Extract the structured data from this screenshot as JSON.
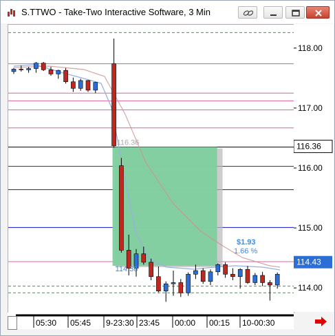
{
  "window": {
    "title": "S.TTWO - Take-Two Interactive Software, 3 Min",
    "icon": "chart-app-icon"
  },
  "titlebar_buttons": [
    "link-icon",
    "minimize-icon",
    "restore-icon",
    "close-icon"
  ],
  "price_axis": {
    "labels": [
      "118.00",
      "117.00",
      "116.00",
      "115.00",
      "114.00"
    ],
    "current_price_tag": "114.43",
    "entry_price_tag": "116.36"
  },
  "time_axis": {
    "labels": [
      "05:30",
      "05:45",
      "9-23:30",
      "23:45",
      "00:00",
      "00:15",
      "10-00:30"
    ]
  },
  "annotations": {
    "entry_label": "116.36",
    "exit_label": "114.38",
    "profit_amount": "$1.93",
    "profit_percent": "1.66 %"
  },
  "colors": {
    "up_candle": "#2b6fd6",
    "down_candle": "#c0281f",
    "trade_box": "#7fcf9f",
    "profit_text": "#3a8ee6",
    "blue_level": "#1010c8",
    "dark_red_level": "#a01010",
    "maroon_level": "#800060"
  },
  "chart_data": {
    "type": "candlestick",
    "symbol": "S.TTWO",
    "interval": "3 Min",
    "ylim": [
      113.6,
      118.4
    ],
    "candles": [
      {
        "o": 117.62,
        "h": 117.68,
        "l": 117.58,
        "c": 117.66
      },
      {
        "o": 117.66,
        "h": 117.72,
        "l": 117.62,
        "c": 117.65
      },
      {
        "o": 117.65,
        "h": 117.7,
        "l": 117.6,
        "c": 117.67
      },
      {
        "o": 117.67,
        "h": 117.78,
        "l": 117.6,
        "c": 117.76
      },
      {
        "o": 117.76,
        "h": 117.78,
        "l": 117.63,
        "c": 117.65
      },
      {
        "o": 117.65,
        "h": 117.7,
        "l": 117.55,
        "c": 117.58
      },
      {
        "o": 117.58,
        "h": 117.65,
        "l": 117.5,
        "c": 117.64
      },
      {
        "o": 117.64,
        "h": 117.68,
        "l": 117.42,
        "c": 117.45
      },
      {
        "o": 117.45,
        "h": 117.52,
        "l": 117.28,
        "c": 117.34
      },
      {
        "o": 117.34,
        "h": 117.5,
        "l": 117.3,
        "c": 117.47
      },
      {
        "o": 117.47,
        "h": 117.48,
        "l": 117.28,
        "c": 117.31
      },
      {
        "o": 117.31,
        "h": 117.45,
        "l": 117.26,
        "c": 117.44
      },
      {
        "o": 117.75,
        "h": 118.17,
        "l": 116.35,
        "c": 116.38
      },
      {
        "o": 116.05,
        "h": 116.18,
        "l": 114.6,
        "c": 114.64
      },
      {
        "o": 114.64,
        "h": 114.9,
        "l": 114.22,
        "c": 114.34
      },
      {
        "o": 114.34,
        "h": 114.66,
        "l": 114.2,
        "c": 114.58
      },
      {
        "o": 114.58,
        "h": 114.7,
        "l": 114.4,
        "c": 114.44
      },
      {
        "o": 114.44,
        "h": 114.5,
        "l": 114.14,
        "c": 114.2
      },
      {
        "o": 114.2,
        "h": 114.37,
        "l": 113.94,
        "c": 113.96
      },
      {
        "o": 113.96,
        "h": 114.12,
        "l": 113.78,
        "c": 114.08
      },
      {
        "o": 114.08,
        "h": 114.3,
        "l": 113.88,
        "c": 114.1
      },
      {
        "o": 114.1,
        "h": 114.16,
        "l": 113.86,
        "c": 113.93
      },
      {
        "o": 113.93,
        "h": 114.27,
        "l": 113.88,
        "c": 114.24
      },
      {
        "o": 114.24,
        "h": 114.4,
        "l": 114.16,
        "c": 114.3
      },
      {
        "o": 114.3,
        "h": 114.34,
        "l": 114.08,
        "c": 114.12
      },
      {
        "o": 114.12,
        "h": 114.32,
        "l": 114.06,
        "c": 114.28
      },
      {
        "o": 114.28,
        "h": 114.42,
        "l": 114.22,
        "c": 114.4
      },
      {
        "o": 114.4,
        "h": 114.44,
        "l": 114.18,
        "c": 114.24
      },
      {
        "o": 114.24,
        "h": 114.34,
        "l": 114.14,
        "c": 114.2
      },
      {
        "o": 114.2,
        "h": 114.34,
        "l": 114.0,
        "c": 114.32
      },
      {
        "o": 114.32,
        "h": 114.38,
        "l": 114.08,
        "c": 114.1
      },
      {
        "o": 114.1,
        "h": 114.26,
        "l": 114.06,
        "c": 114.22
      },
      {
        "o": 114.22,
        "h": 114.28,
        "l": 114.04,
        "c": 114.1
      },
      {
        "o": 114.1,
        "h": 114.14,
        "l": 113.8,
        "c": 114.06
      },
      {
        "o": 114.06,
        "h": 114.27,
        "l": 114.0,
        "c": 114.24
      }
    ],
    "horizontal_levels": [
      {
        "price": 118.27,
        "color": "#22aa22",
        "dash": true
      },
      {
        "price": 117.75,
        "color": "#888888",
        "dash": false
      },
      {
        "price": 117.26,
        "color": "#e060a0",
        "dash": false
      },
      {
        "price": 117.13,
        "color": "#e060a0",
        "dash": false
      },
      {
        "price": 116.98,
        "color": "#d060c0",
        "dash": false
      },
      {
        "price": 116.68,
        "color": "#e060a0",
        "dash": false
      },
      {
        "price": 116.36,
        "color": "#000000",
        "dash": false
      },
      {
        "price": 116.04,
        "color": "#a01010",
        "dash": false
      },
      {
        "price": 115.65,
        "color": "#800060",
        "dash": false
      },
      {
        "price": 115.02,
        "color": "#1010c8",
        "dash": false
      },
      {
        "price": 114.45,
        "color": "#e060a0",
        "dash": false
      },
      {
        "price": 114.04,
        "color": "#22aa22",
        "dash": true
      },
      {
        "price": 113.93,
        "color": "#22aa22",
        "dash": true
      }
    ],
    "trade": {
      "entry": 116.36,
      "exit": 114.38,
      "profit": "$1.93",
      "percent": "1.66 %"
    }
  }
}
